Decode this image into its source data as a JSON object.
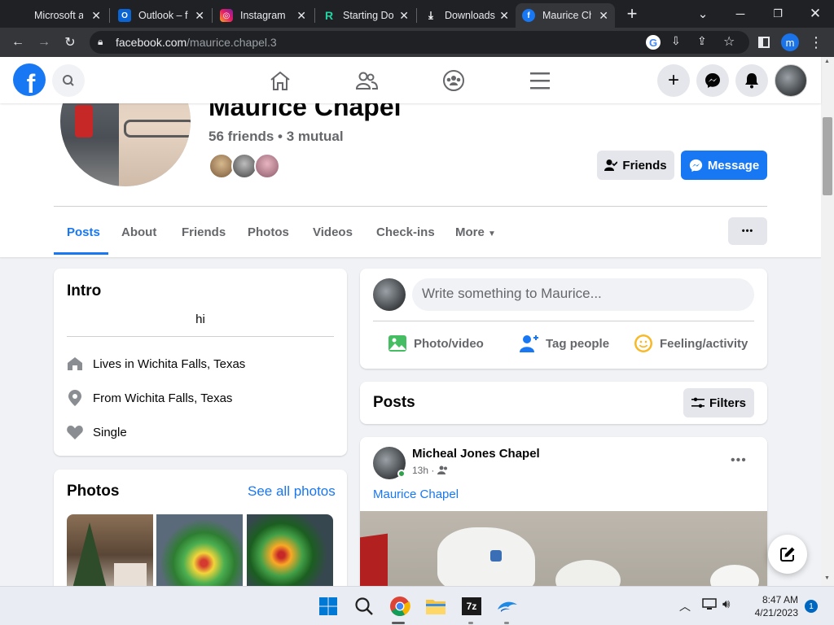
{
  "browser": {
    "tabs": [
      {
        "title": "Microsoft a",
        "favicon": "microsoft-icon"
      },
      {
        "title": "Outlook – f",
        "favicon": "outlook-icon"
      },
      {
        "title": "Instagram",
        "favicon": "instagram-icon"
      },
      {
        "title": "Starting Do",
        "favicon": "r-icon"
      },
      {
        "title": "Downloads",
        "favicon": "download-icon"
      },
      {
        "title": "Maurice Ch",
        "favicon": "facebook-icon"
      }
    ],
    "url_domain": "facebook.com",
    "url_path": "/maurice.chapel.3",
    "profile_letter": "m"
  },
  "profile": {
    "name": "Maurice Chapel",
    "friends_line": "56 friends • 3 mutual",
    "friends_button": "Friends",
    "message_button": "Message",
    "more_options": "•••"
  },
  "nav_tabs": [
    "Posts",
    "About",
    "Friends",
    "Photos",
    "Videos",
    "Check-ins",
    "More"
  ],
  "intro": {
    "title": "Intro",
    "bio": "hi",
    "lives_prefix": "Lives in ",
    "lives_city": "Wichita Falls, Texas",
    "from_prefix": "From ",
    "from_city": "Wichita Falls, Texas",
    "relationship": "Single"
  },
  "photos": {
    "title": "Photos",
    "see_all": "See all photos"
  },
  "composer": {
    "placeholder": "Write something to Maurice...",
    "photo_video": "Photo/video",
    "tag_people": "Tag people",
    "feeling": "Feeling/activity"
  },
  "posts_header": {
    "title": "Posts",
    "filters": "Filters"
  },
  "post": {
    "author": "Micheal Jones Chapel",
    "time": "13h ·",
    "tagged": "Maurice Chapel"
  },
  "taskbar": {
    "time": "8:47 AM",
    "date": "4/21/2023",
    "notification_count": "1"
  },
  "colors": {
    "fb_blue": "#1877f2",
    "chrome_dark": "#202124",
    "chrome_toolbar": "#35363a"
  }
}
